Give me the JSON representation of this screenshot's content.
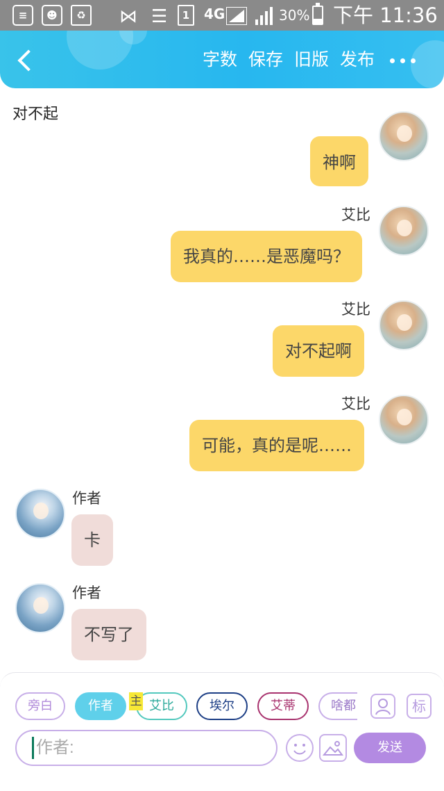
{
  "status_bar": {
    "network": "4G",
    "sim_slot": "1",
    "battery_percent": "30%",
    "battery_level": 0.3,
    "time": "下午 11:36"
  },
  "header": {
    "buttons": [
      "字数",
      "保存",
      "旧版",
      "发布"
    ]
  },
  "chapter": {
    "title": "对不起"
  },
  "messages": [
    {
      "side": "right",
      "speaker": "",
      "text": "神啊"
    },
    {
      "side": "right",
      "speaker": "艾比",
      "text": "我真的……是恶魔吗？"
    },
    {
      "side": "right",
      "speaker": "艾比",
      "text": "对不起啊"
    },
    {
      "side": "right",
      "speaker": "艾比",
      "text": "可能，真的是呢……"
    },
    {
      "side": "left",
      "speaker": "作者",
      "text": "卡"
    },
    {
      "side": "left",
      "speaker": "作者",
      "text": "不写了"
    }
  ],
  "roles": [
    {
      "label": "旁白",
      "color": "#c7aee8",
      "text_color": "#b08ada",
      "active": false
    },
    {
      "label": "作者",
      "color": "#5fd0ea",
      "text_color": "#ffffff",
      "active": true
    },
    {
      "label": "艾比",
      "color": "#52c8bd",
      "text_color": "#2ba99a",
      "active": false,
      "tag": "主"
    },
    {
      "label": "埃尔",
      "color": "#1c3e85",
      "text_color": "#1c3e85",
      "active": false
    },
    {
      "label": "艾蒂",
      "color": "#a8326e",
      "text_color": "#a8326e",
      "active": false
    },
    {
      "label": "啥都",
      "color": "#c7aee8",
      "text_color": "#9a78c8",
      "active": false
    }
  ],
  "tools": {
    "mark_label": "标"
  },
  "composer": {
    "placeholder": "作者:",
    "send_label": "发送"
  },
  "colors": {
    "header": "#27b7ef",
    "bubble_right": "#fcd769",
    "bubble_left": "#f0dcd9",
    "accent": "#b38ae2"
  }
}
